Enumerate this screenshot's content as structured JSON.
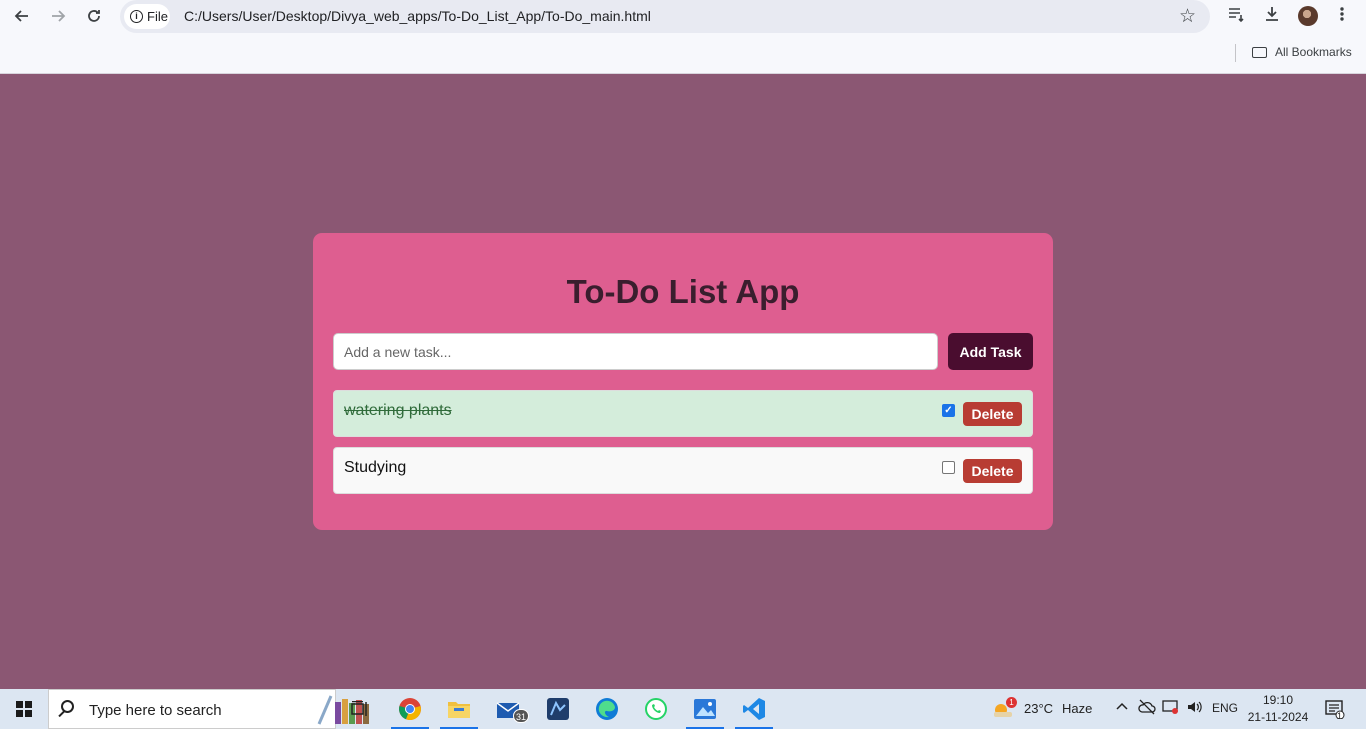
{
  "browser": {
    "url": "C:/Users/User/Desktop/Divya_web_apps/To-Do_List_App/To-Do_main.html",
    "file_label": "File",
    "bookmarks_label": "All Bookmarks"
  },
  "app": {
    "title": "To-Do List App",
    "input_placeholder": "Add a new task...",
    "input_value": "",
    "add_button": "Add Task",
    "tasks": [
      {
        "text": "watering plants",
        "completed": true,
        "delete_label": "Delete"
      },
      {
        "text": "Studying",
        "completed": false,
        "delete_label": "Delete"
      }
    ]
  },
  "taskbar": {
    "search_placeholder": "Type here to search",
    "mail_badge": "31",
    "weather_temp": "23°C",
    "weather_desc": "Haze",
    "weather_badge": "1",
    "language": "ENG",
    "time": "19:10",
    "date": "21-11-2024",
    "notification_count": "1"
  },
  "colors": {
    "page_bg": "#8b5773",
    "card_bg": "#de5e90",
    "title": "#3a1e2e",
    "add_button": "#4a0d2f",
    "delete_button": "#b83c33",
    "completed_task_bg": "#d4eddb"
  }
}
